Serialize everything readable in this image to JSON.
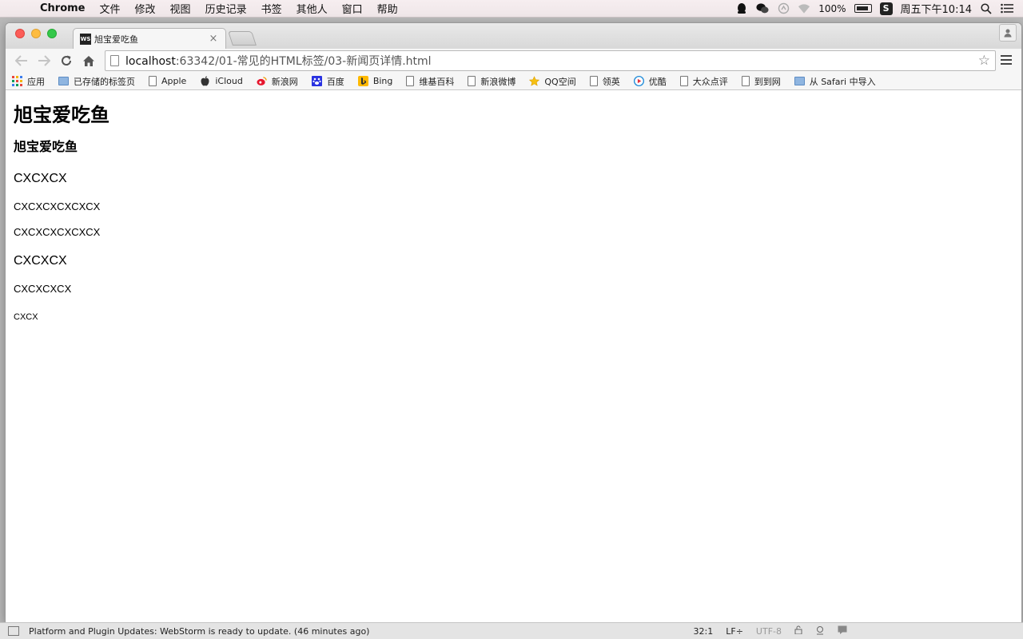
{
  "menubar": {
    "app": "Chrome",
    "items": [
      "文件",
      "修改",
      "视图",
      "历史记录",
      "书签",
      "其他人",
      "窗口",
      "帮助"
    ],
    "battery": "100%",
    "clock": "周五下午10:14"
  },
  "tab": {
    "favicon": "WS",
    "title": "旭宝爱吃鱼",
    "close": "×"
  },
  "omnibox": {
    "host": "localhost",
    "path": ":63342/01-常见的HTML标签/03-新闻页详情.html"
  },
  "bookmarks": [
    {
      "label": "应用",
      "icon": "apps"
    },
    {
      "label": "已存储的标签页",
      "icon": "folder"
    },
    {
      "label": "Apple",
      "icon": "apple"
    },
    {
      "label": "iCloud",
      "icon": "apple"
    },
    {
      "label": "新浪网",
      "icon": "sina"
    },
    {
      "label": "百度",
      "icon": "baidu"
    },
    {
      "label": "Bing",
      "icon": "bing"
    },
    {
      "label": "维基百科",
      "icon": "page"
    },
    {
      "label": "新浪微博",
      "icon": "page"
    },
    {
      "label": "QQ空间",
      "icon": "star"
    },
    {
      "label": "领英",
      "icon": "page"
    },
    {
      "label": "优酷",
      "icon": "youku"
    },
    {
      "label": "大众点评",
      "icon": "page"
    },
    {
      "label": "到到网",
      "icon": "page"
    },
    {
      "label": "从 Safari 中导入",
      "icon": "folder"
    }
  ],
  "content": {
    "h1": "旭宝爱吃鱼",
    "h2": "旭宝爱吃鱼",
    "line1": "CXCXCX",
    "line2": "CXCXCXCXCXCX",
    "line3": "CXCXCXCXCXCX",
    "line4": "CXCXCX",
    "line5": "CXCXCXCX",
    "line6": "CXCX"
  },
  "statusbar": {
    "message": "Platform and Plugin Updates: WebStorm is ready to update. (46 minutes ago)",
    "position": "32:1",
    "line_sep": "LF÷",
    "encoding": "UTF-8"
  }
}
